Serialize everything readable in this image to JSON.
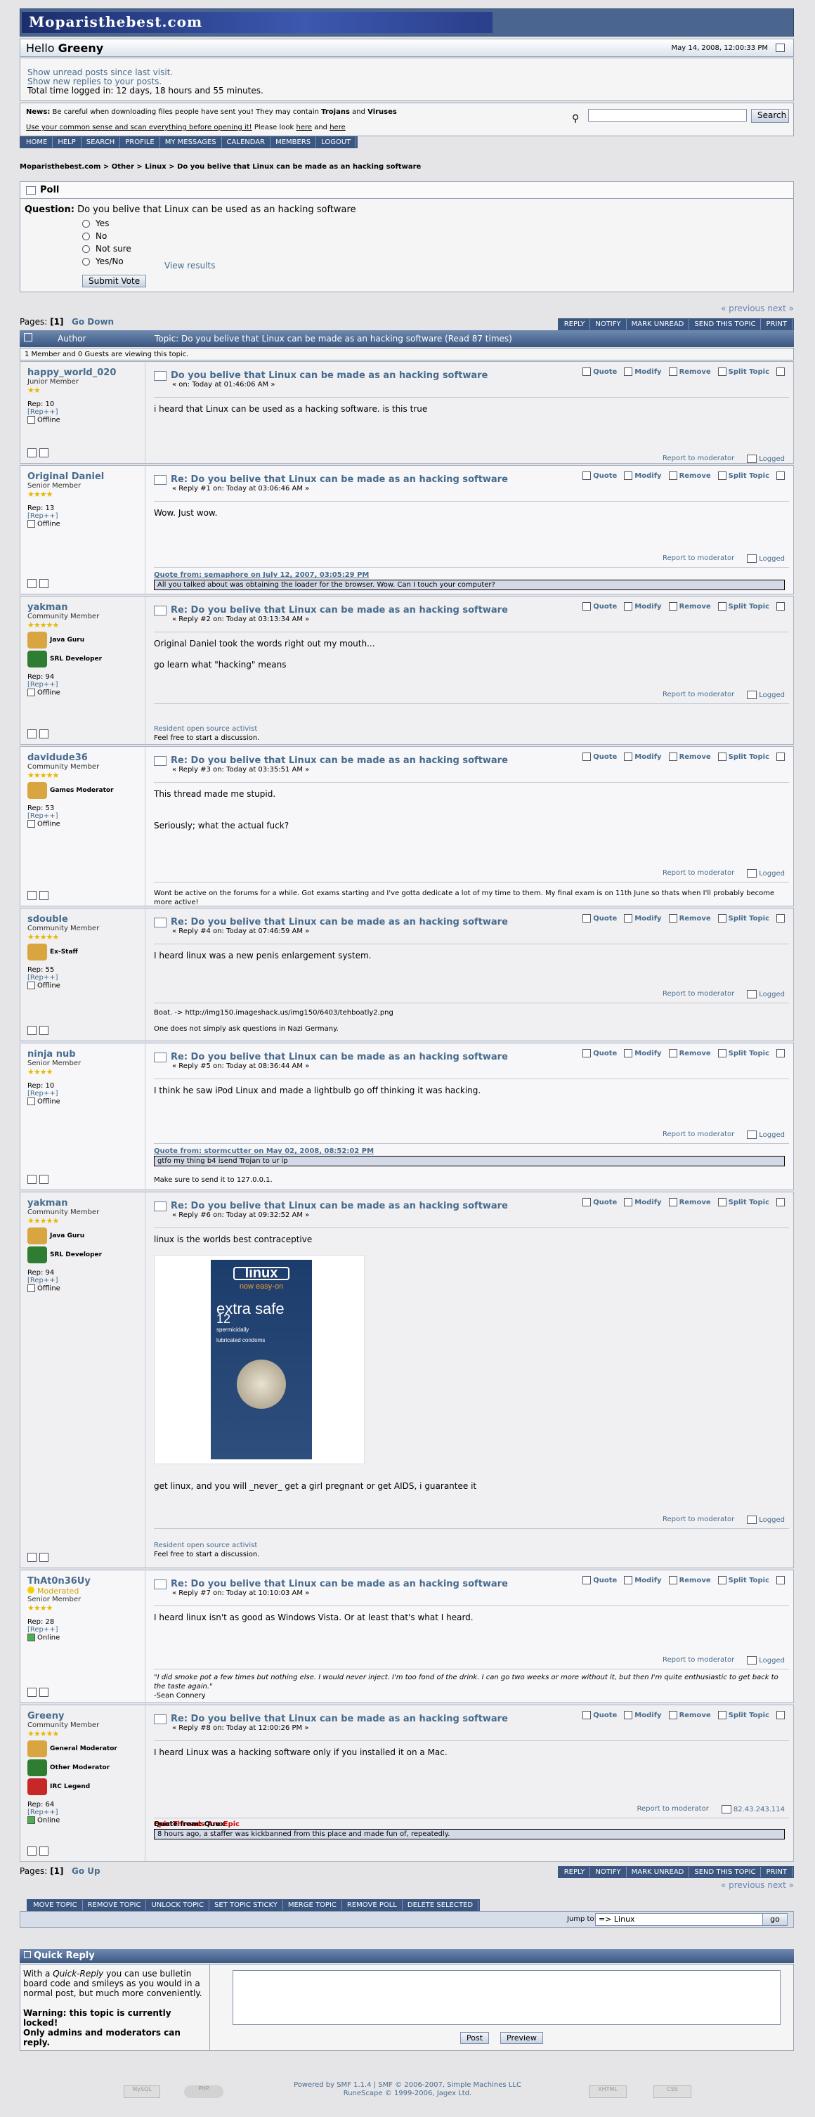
{
  "header": {
    "logo": "Moparisthebest.com",
    "hello_prefix": "Hello",
    "username": "Greeny",
    "datetime": "May 14, 2008, 12:00:33 PM",
    "unread_since": "Show unread posts since last visit.",
    "new_replies": "Show new replies to your posts.",
    "time_logged": "Total time logged in: 12 days, 18 hours and 55 minutes.",
    "news_label": "News:",
    "news_text": "Be careful when downloading files people have sent you!  They may contain",
    "news_b1": "Trojans",
    "news_and": "and",
    "news_b2": "Viruses",
    "news_line2": "Use your common sense and scan everything before opening it!",
    "news_look": "Please look",
    "news_here1": "here",
    "news_here2": "here",
    "search_button": "Search"
  },
  "nav": [
    "HOME",
    "HELP",
    "SEARCH",
    "PROFILE",
    "MY MESSAGES",
    "CALENDAR",
    "MEMBERS",
    "LOGOUT"
  ],
  "breadcrumb": [
    "Moparisthebest.com",
    "Other",
    "Linux",
    "Do you belive that Linux can be made as an hacking software"
  ],
  "poll": {
    "title": "Poll",
    "question_label": "Question:",
    "question": "Do you belive that Linux can be used as an hacking software",
    "options": [
      "Yes",
      "No",
      "Not sure",
      "Yes/No"
    ],
    "view_results": "View results",
    "submit": "Submit Vote"
  },
  "pagination": {
    "prev": "« previous",
    "next": "next »",
    "pages_label": "Pages:",
    "page": "[1]",
    "go_down": "Go Down",
    "go_up": "Go Up"
  },
  "topic_buttons": [
    "REPLY",
    "NOTIFY",
    "MARK UNREAD",
    "SEND THIS TOPIC",
    "PRINT"
  ],
  "topic_header": {
    "author": "Author",
    "topic": "Topic: Do you belive that Linux can be made as an hacking software  (Read 87 times)"
  },
  "viewing": "1 Member and 0 Guests are viewing this topic.",
  "actions": {
    "quote": "Quote",
    "modify": "Modify",
    "remove": "Remove",
    "split": "Split Topic",
    "report": "Report to moderator",
    "logged": "Logged",
    "offline": "Offline",
    "online": "Online",
    "rep_plus": "[Rep++]"
  },
  "posts": [
    {
      "name": "happy_world_020",
      "group": "Junior Member",
      "stars": "★★",
      "rep": "Rep: 10",
      "status": "Offline",
      "title": "Do you belive that Linux can be made as an hacking software",
      "meta": "« on: Today at 01:46:06 AM »",
      "body": [
        "i heard that Linux can be used as a hacking software. is this true"
      ]
    },
    {
      "name": "Original Daniel",
      "group": "Senior Member",
      "stars": "★★★★",
      "rep": "Rep: 13",
      "status": "Offline",
      "title": "Re: Do you belive that Linux can be made as an hacking software",
      "meta": "« Reply #1 on: Today at 03:06:46 AM »",
      "body": [
        "Wow. Just wow."
      ],
      "quote_head": "Quote from: semaphore on July 12, 2007, 03:05:29 PM",
      "quote_body": "All you talked about was obtaining the loader for the browser. Wow. Can I touch your computer?"
    },
    {
      "name": "yakman",
      "group": "Community Member",
      "stars": "★★★★★",
      "badges": [
        "Java Guru",
        "SRL Developer"
      ],
      "rep": "Rep: 94",
      "status": "Offline",
      "title": "Re: Do you belive that Linux can be made as an hacking software",
      "meta": "« Reply #2 on: Today at 03:13:34 AM »",
      "body": [
        "Original Daniel took the words right out my mouth...",
        "",
        "go learn what \"hacking\" means"
      ],
      "sig1": "Resident open source activist",
      "sig2": "Feel free to start a discussion."
    },
    {
      "name": "davidude36",
      "group": "Community Member",
      "stars": "★★★★★",
      "badges": [
        "Games Moderator"
      ],
      "rep": "Rep: 53",
      "status": "Offline",
      "title": "Re: Do you belive that Linux can be made as an hacking software",
      "meta": "« Reply #3 on: Today at 03:35:51 AM »",
      "body": [
        "This thread made me stupid.",
        "",
        "",
        "Seriously; what the actual fuck?"
      ],
      "sig1": "Wont be active on the forums for a while. Got exams starting and I've gotta dedicate a lot of my time to them. My final exam is on 11th June so thats when I'll probably become more active!"
    },
    {
      "name": "sdouble",
      "group": "Community Member",
      "stars": "★★★★★",
      "badges": [
        "Ex-Staff"
      ],
      "rep": "Rep: 55",
      "status": "Offline",
      "title": "Re: Do you belive that Linux can be made as an hacking software",
      "meta": "« Reply #4 on: Today at 07:46:59 AM »",
      "body": [
        "I heard linux was a new penis enlargement system."
      ],
      "sig1": "Boat.  ->  http://img150.imageshack.us/img150/6403/tehboatly2.png",
      "sig2": "One does not simply ask questions in Nazi Germany."
    },
    {
      "name": "ninja nub",
      "group": "Senior Member",
      "stars": "★★★★",
      "rep": "Rep: 10",
      "status": "Offline",
      "title": "Re: Do you belive that Linux can be made as an hacking software",
      "meta": "« Reply #5 on: Today at 08:36:44 AM »",
      "body": [
        "I think he saw iPod Linux and made a lightbulb go off thinking it was hacking."
      ],
      "quote_head": "Quote from: stormcutter on May 02, 2008, 08:52:02 PM",
      "quote_body": "gtfo my thing b4 isend Trojan to ur ip",
      "sig1": "Make sure to send it to 127.0.0.1."
    },
    {
      "name": "yakman",
      "group": "Community Member",
      "stars": "★★★★★",
      "badges": [
        "Java Guru",
        "SRL Developer"
      ],
      "rep": "Rep: 94",
      "status": "Offline",
      "title": "Re: Do you belive that Linux can be made as an hacking software",
      "meta": "« Reply #6 on: Today at 09:32:52 AM »",
      "body": [
        "linux is the worlds best contraceptive"
      ],
      "image": {
        "brand": "linux",
        "sub": "now easy-on",
        "big": "extra safe",
        "count": "12",
        "desc": "spermicidally lubricated condoms"
      },
      "body2": "get linux, and you will _never_ get a girl pregnant or get AIDS, i guarantee it",
      "sig1": "Resident open source activist",
      "sig2": "Feel free to start a discussion."
    },
    {
      "name": "ThAt0n36Uy",
      "moderated": "Moderated",
      "group": "Senior Member",
      "stars": "★★★★",
      "rep": "Rep: 28",
      "status": "Online",
      "title": "Re: Do you belive that Linux can be made as an hacking software",
      "meta": "« Reply #7 on: Today at 10:10:03 AM »",
      "body": [
        "I heard linux isn't as good as Windows Vista. Or at least that's what I heard."
      ],
      "sig1": "\"I did smoke pot a few times but nothing else. I would never inject. I'm too fond of the drink. I can go two weeks or more without it, but then I'm quite enthusiastic to get back to the taste again.\"",
      "sig2": "-Sean Connery"
    },
    {
      "name": "Greeny",
      "group": "Community Member",
      "stars": "★★★★★",
      "badges": [
        "General Moderator",
        "Other Moderator",
        "IRC Legend"
      ],
      "rep": "Rep: 64",
      "status": "Online",
      "title": "Re: Do you belive that Linux can be made as an hacking software",
      "meta": "« Reply #8 on: Today at 12:00:26 PM »",
      "body": [
        "I heard Linux was a hacking software only if you installed it on a Mac."
      ],
      "ip": "82.43.243.114",
      "sig_red": "Epic Threads Are Epic",
      "quote_head": "Quote from: Quux",
      "quote_body": "8 hours ago, a staffer was kickbanned from this place and made fun of, repeatedly."
    }
  ],
  "mod_buttons": [
    "MOVE TOPIC",
    "REMOVE TOPIC",
    "UNLOCK TOPIC",
    "SET TOPIC STICKY",
    "MERGE TOPIC",
    "REMOVE POLL",
    "DELETE SELECTED"
  ],
  "jump": {
    "label": "Jump to:",
    "value": "=> Linux",
    "go": "go"
  },
  "quick_reply": {
    "title": "Quick Reply",
    "intro_a": "With a",
    "intro_b": "Quick-Reply",
    "intro_c": "you can use bulletin board code and smileys as you would in a normal post, but much more conveniently.",
    "warning": "Warning: this topic is currently locked!",
    "only": "Only admins and moderators can reply.",
    "post": "Post",
    "preview": "Preview"
  },
  "footer": {
    "line1": "Powered by SMF 1.1.4 | SMF © 2006-2007, Simple Machines LLC",
    "line2": "RuneScape © 1999-2006, Jagex Ltd.",
    "b1": "MySQL",
    "b2": "PHP",
    "b3": "XHTML",
    "b4": "CSS"
  }
}
